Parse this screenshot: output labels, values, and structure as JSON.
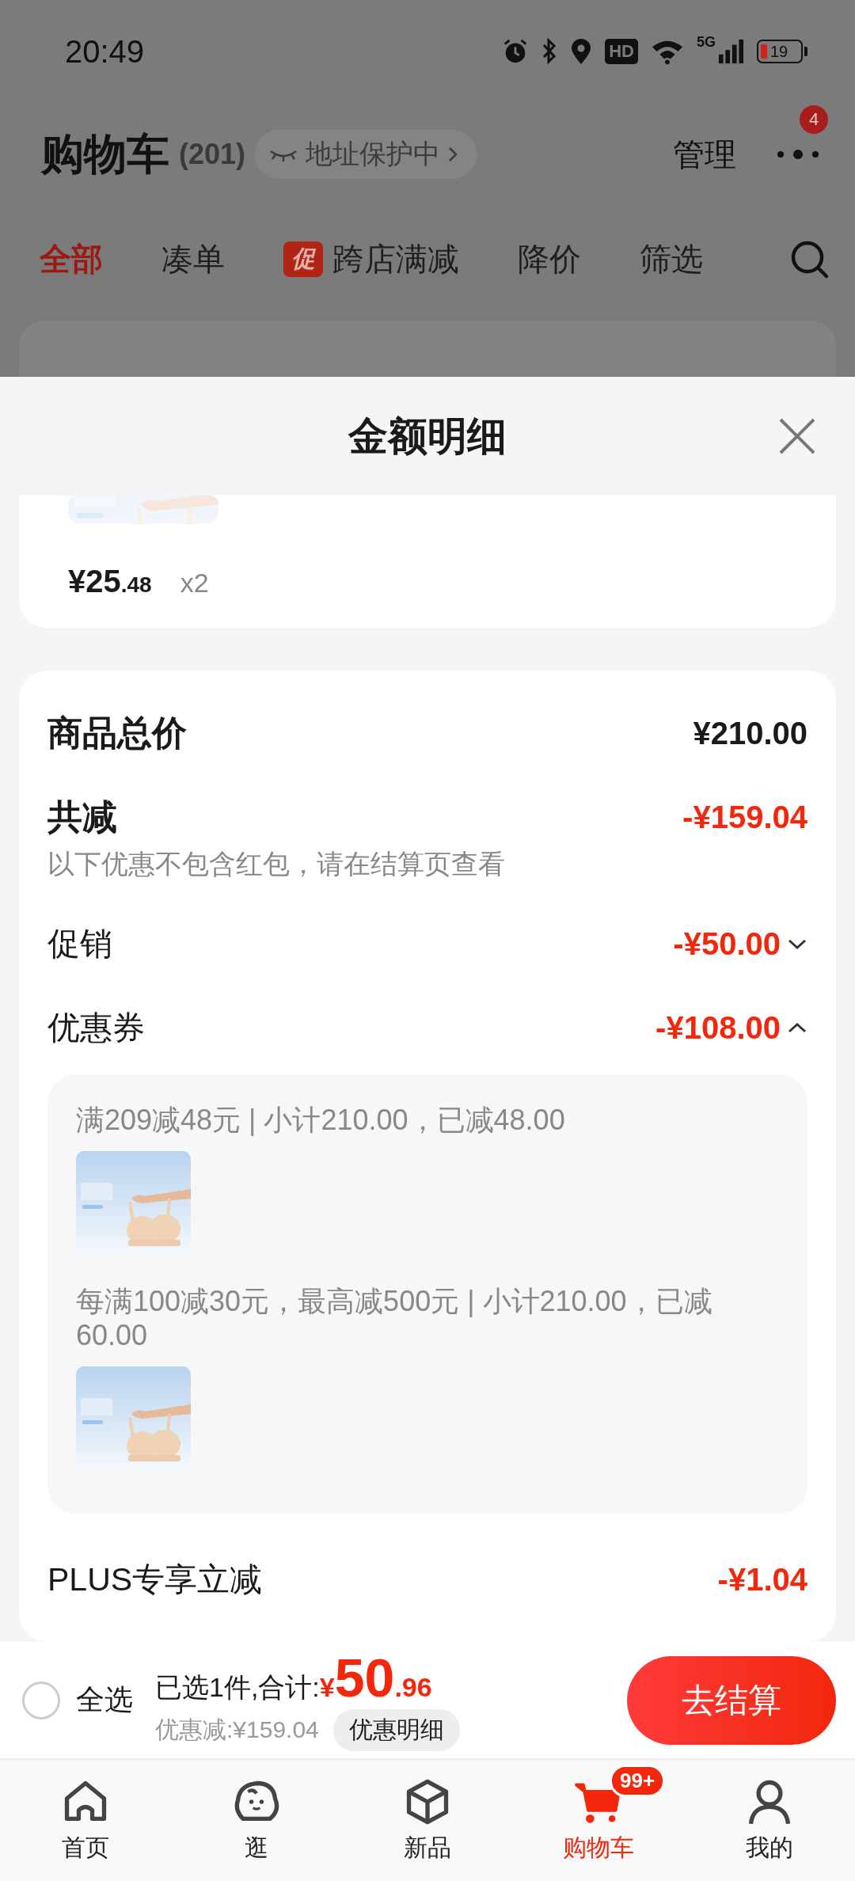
{
  "status_bar": {
    "time": "20:49",
    "hd": "HD",
    "network": "5G",
    "battery": "19"
  },
  "header": {
    "title": "购物车",
    "count": "(201)",
    "address_badge": "地址保护中",
    "manage": "管理",
    "more_badge": "4"
  },
  "tabs": [
    {
      "label": "全部",
      "selected": true
    },
    {
      "label": "凑单",
      "selected": false
    },
    {
      "label": "跨店满减",
      "selected": false,
      "tag": "促"
    },
    {
      "label": "降价",
      "selected": false
    },
    {
      "label": "筛选",
      "selected": false
    }
  ],
  "sheet": {
    "title": "金额明细",
    "item": {
      "price_main": "¥25",
      "price_decimal": ".48",
      "quantity": "x2"
    },
    "rows": [
      {
        "kind": "total",
        "label": "商品总价",
        "value": "¥210.00"
      },
      {
        "kind": "reduction",
        "label": "共减",
        "value": "-¥159.04",
        "note": "以下优惠不包含红包，请在结算页查看"
      },
      {
        "kind": "discount",
        "label": "促销",
        "value": "-¥50.00",
        "expanded": false
      },
      {
        "kind": "discount",
        "label": "优惠券",
        "value": "-¥108.00",
        "expanded": true,
        "details": [
          {
            "text": "满209减48元 | 小计210.00，已减48.00"
          },
          {
            "text": "每满100减30元，最高减500元 | 小计210.00，已减60.00"
          }
        ]
      },
      {
        "kind": "discount",
        "label": "PLUS专享立减",
        "value": "-¥1.04"
      }
    ]
  },
  "checkout": {
    "select_all": {
      "label": "全选",
      "checked": false
    },
    "summary_label": "已选1件,合计:",
    "currency": "¥",
    "total_main": "50",
    "total_decimal": ".96",
    "discount": "优惠减:¥159.04",
    "detail_button": "优惠明细",
    "checkout_button": "去结算"
  },
  "nav": [
    {
      "kind": "home",
      "label": "首页",
      "selected": false
    },
    {
      "kind": "browse",
      "label": "逛",
      "selected": false
    },
    {
      "kind": "new",
      "label": "新品",
      "selected": false
    },
    {
      "kind": "cart",
      "label": "购物车",
      "selected": true,
      "badge": "99+"
    },
    {
      "kind": "me",
      "label": "我的",
      "selected": false
    }
  ]
}
